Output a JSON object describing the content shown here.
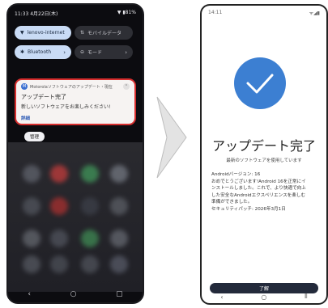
{
  "left_phone": {
    "status": {
      "time": "11:33 4月22日(木)",
      "indicators": "▼ ▮81%"
    },
    "quick_settings": [
      {
        "label": "lenovo-internet",
        "icon": "wifi-icon",
        "state": "on",
        "arrow": ""
      },
      {
        "label": "モバイルデータ",
        "icon": "mobile-data-icon",
        "state": "off",
        "arrow": ""
      },
      {
        "label": "Bluetooth",
        "icon": "bluetooth-icon",
        "state": "on",
        "arrow": "›"
      },
      {
        "label": "モード",
        "icon": "mode-icon",
        "state": "off",
        "arrow": "›"
      }
    ],
    "notification": {
      "header": "Motorolaソフトウェアのアップデート・現在",
      "title": "アップデート完了",
      "body": "新しいソフトウェアをお楽しみください!",
      "action": "詳細"
    },
    "manage_label": "管理",
    "nav": {
      "back": "‹",
      "home": "○",
      "recents": "▢"
    }
  },
  "arrow": {
    "color": "#e3e3e3"
  },
  "right_phone": {
    "status": {
      "time": "14:11",
      "indicators": "ᯤ◢▮"
    },
    "title": "アップデート完了",
    "subtitle": "最新のソフトウェアを使用しています",
    "info_lines": [
      "Androidバージョン: 16",
      "おめでとうございます!Android 16を正常にイ",
      "ンストールしました。これで、より快適で向上",
      "した安全なAndroidエクスペリエンスを楽しむ",
      "準備ができました。",
      "セキュリティパッチ: 2026年3月1日"
    ],
    "ok_label": "了解",
    "nav": {
      "back": "‹",
      "home": "○",
      "recents": "⦀"
    }
  },
  "colors": {
    "accent_blue": "#3c7fd2",
    "highlight_red": "#d72e2e",
    "button_dark": "#232a3b"
  }
}
